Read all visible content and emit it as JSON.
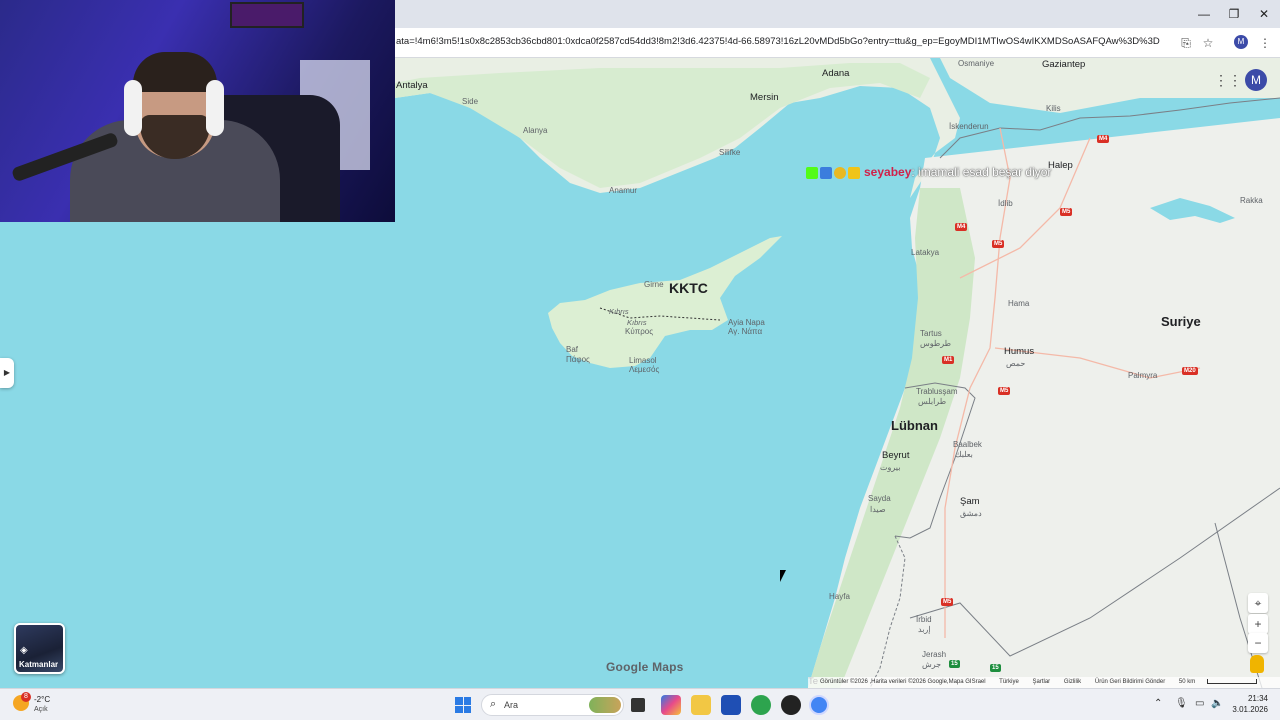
{
  "browser": {
    "url": "ata=!4m6!3m5!1s0x8c2853cb36cbd801:0xdca0f2587cd54dd3!8m2!3d6.42375!4d-66.58973!16zL20vMDd5bGo?entry=ttu&g_ep=EgoyMDI1MTIwOS4wIKXMDSoASAFQAw%3D%3D",
    "window_controls": [
      "—",
      "❐",
      "✕"
    ],
    "profile_initial": "M"
  },
  "map": {
    "country_labels": {
      "kktc": "KKTC",
      "suriye": "Suriye",
      "lubnan": "Lübnan"
    },
    "cities": {
      "antalya": "Antalya",
      "side": "Side",
      "alanya": "Alanya",
      "anamur": "Anamur",
      "silifke": "Silifke",
      "mersin": "Mersin",
      "adana": "Adana",
      "osmaniye": "Osmaniye",
      "gaziantep": "Gaziantep",
      "kilis": "Kilis",
      "iskenderun": "İskenderun",
      "halep": "Halep",
      "idlib": "İdlib",
      "rakka": "Rakka",
      "latakya": "Latakya",
      "hama": "Hama",
      "tartus": "Tartus",
      "tartus_ar": "طرطوس",
      "humus": "Humus",
      "humus_ar": "حمص",
      "palmyra": "Palmyra",
      "trablussam": "Trablusşam",
      "trablussam_ar": "طرابلس",
      "baalbek": "Baalbek",
      "baalbek_ar": "بعلبك",
      "beyrut": "Beyrut",
      "beyrut_ar": "بيروت",
      "sayda": "Sayda",
      "sayda_ar": "صيدا",
      "sam": "Şam",
      "sam_ar": "دمشق",
      "hayfa": "Hayfa",
      "irbid": "İrbid",
      "irbid_ar": "إربد",
      "jerash": "Jerash",
      "jerash_ar": "جرش",
      "tel_aviv_partial": "Te",
      "girne": "Girne",
      "kibris_it": "Kıbrıs",
      "kibris": "Kıbrıs",
      "kypros": "Κύπρος",
      "ayia_napa": "Ayia Napa",
      "ayia_napa_gr": "Αγ. Νάπα",
      "baf": "Baf",
      "pafos": "Πάφος",
      "limasol": "Limasol",
      "lemesos": "Λεμεσός"
    },
    "highways": [
      "M4",
      "M5",
      "M4",
      "M1",
      "M5",
      "M1",
      "M5",
      "M20",
      "M5",
      "15",
      "15"
    ],
    "chat": {
      "user": "seyabey",
      "message": ": imamali esad beşar diyor"
    },
    "layers_label": "Katmanlar",
    "google_logo": "Google Maps",
    "attribution": {
      "data": "Görüntüler ©2026 ,Harita verileri ©2026 Google,Mapa GISrael",
      "region": "Türkiye",
      "terms": "Şartlar",
      "privacy": "Gizlilik",
      "feedback": "Ürün Geri Bildirimi Gönder",
      "scale": "50 km"
    },
    "controls": {
      "locate": "⌖",
      "zoom_in": "+",
      "zoom_out": "−"
    }
  },
  "taskbar": {
    "weather_badge": "8",
    "weather_temp": "-2°C",
    "weather_condition": "Açık",
    "search_placeholder": "Ara",
    "time": "21:34",
    "date": "3.01.2026"
  }
}
